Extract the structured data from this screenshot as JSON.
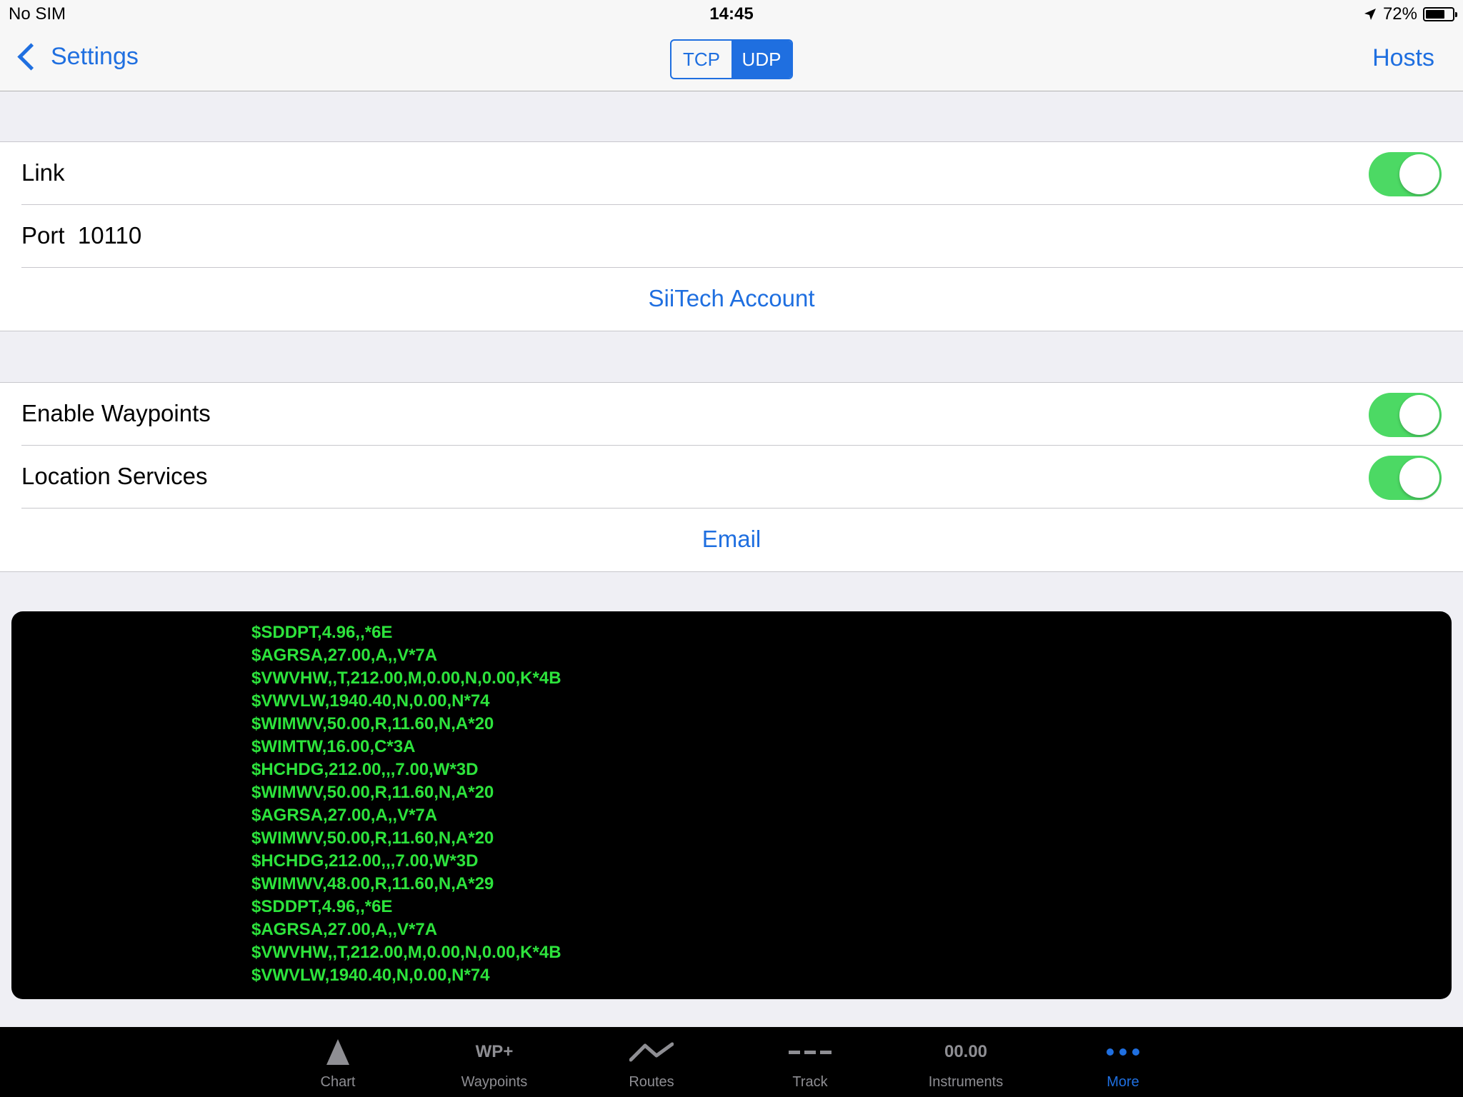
{
  "status_bar": {
    "carrier": "No SIM",
    "time": "14:45",
    "battery_percent": "72%",
    "battery_level": 0.72
  },
  "nav": {
    "back_label": "Settings",
    "segments": [
      "TCP",
      "UDP"
    ],
    "selected_segment": "UDP",
    "right_button": "Hosts"
  },
  "connection": {
    "link_label": "Link",
    "link_enabled": true,
    "port_label": "Port",
    "port_value": "10110",
    "account_button": "SiiTech Account"
  },
  "features": {
    "waypoints_label": "Enable Waypoints",
    "waypoints_enabled": true,
    "location_label": "Location Services",
    "location_enabled": true,
    "email_button": "Email"
  },
  "console": {
    "lines": [
      "$SDDPT,4.96,,*6E",
      "$AGRSA,27.00,A,,V*7A",
      "$VWVHW,,T,212.00,M,0.00,N,0.00,K*4B",
      "$VWVLW,1940.40,N,0.00,N*74",
      "$WIMWV,50.00,R,11.60,N,A*20",
      "$WIMTW,16.00,C*3A",
      "$HCHDG,212.00,,,7.00,W*3D",
      "$WIMWV,50.00,R,11.60,N,A*20",
      "$AGRSA,27.00,A,,V*7A",
      "$WIMWV,50.00,R,11.60,N,A*20",
      "$HCHDG,212.00,,,7.00,W*3D",
      "$WIMWV,48.00,R,11.60,N,A*29",
      "$SDDPT,4.96,,*6E",
      "$AGRSA,27.00,A,,V*7A",
      "$VWVHW,,T,212.00,M,0.00,N,0.00,K*4B",
      "$VWVLW,1940.40,N,0.00,N*74"
    ]
  },
  "tabs": [
    {
      "label": "Chart",
      "icon": "triangle-icon"
    },
    {
      "label": "Waypoints",
      "icon": "waypoint-plus-icon",
      "icon_text": "WP+"
    },
    {
      "label": "Routes",
      "icon": "route-zigzag-icon"
    },
    {
      "label": "Track",
      "icon": "track-dashes-icon"
    },
    {
      "label": "Instruments",
      "icon": "instruments-readout-icon",
      "icon_text": "00.00"
    },
    {
      "label": "More",
      "icon": "more-dots-icon"
    }
  ],
  "selected_tab": "More",
  "colors": {
    "accent": "#1f6fe0",
    "toggle_on": "#4cd964",
    "console_text": "#2de33c",
    "console_bg": "#000000"
  }
}
